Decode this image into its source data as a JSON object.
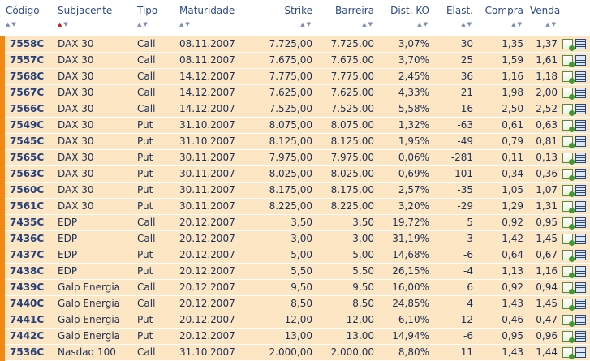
{
  "columns": [
    {
      "label": "Código",
      "sort": "both"
    },
    {
      "label": "Subjacente",
      "sort": "desc-active"
    },
    {
      "label": "Tipo",
      "sort": "both"
    },
    {
      "label": "Maturidade",
      "sort": "both"
    },
    {
      "label": "Strike",
      "sort": "both"
    },
    {
      "label": "Barreira",
      "sort": "both"
    },
    {
      "label": "Dist. KO",
      "sort": "both"
    },
    {
      "label": "Elast.",
      "sort": "both"
    },
    {
      "label": "Compra",
      "sort": "both"
    },
    {
      "label": "Venda",
      "sort": "both"
    }
  ],
  "icons": {
    "details": "document-plus-icon",
    "calculator": "calculator-icon"
  },
  "colors": {
    "row_bg": "#fde6c4",
    "row_marker": "#f08a14",
    "header_text": "#2d4a86"
  },
  "rows": [
    {
      "code": "7558C",
      "underlying": "DAX 30",
      "type": "Call",
      "maturity": "08.11.2007",
      "strike": "7.725,00",
      "barrier": "7.725,00",
      "dist_ko": "3,07%",
      "elast": "30",
      "buy": "1,35",
      "sell": "1,37"
    },
    {
      "code": "7557C",
      "underlying": "DAX 30",
      "type": "Call",
      "maturity": "08.11.2007",
      "strike": "7.675,00",
      "barrier": "7.675,00",
      "dist_ko": "3,70%",
      "elast": "25",
      "buy": "1,59",
      "sell": "1,61"
    },
    {
      "code": "7568C",
      "underlying": "DAX 30",
      "type": "Call",
      "maturity": "14.12.2007",
      "strike": "7.775,00",
      "barrier": "7.775,00",
      "dist_ko": "2,45%",
      "elast": "36",
      "buy": "1,16",
      "sell": "1,18"
    },
    {
      "code": "7567C",
      "underlying": "DAX 30",
      "type": "Call",
      "maturity": "14.12.2007",
      "strike": "7.625,00",
      "barrier": "7.625,00",
      "dist_ko": "4,33%",
      "elast": "21",
      "buy": "1,98",
      "sell": "2,00"
    },
    {
      "code": "7566C",
      "underlying": "DAX 30",
      "type": "Call",
      "maturity": "14.12.2007",
      "strike": "7.525,00",
      "barrier": "7.525,00",
      "dist_ko": "5,58%",
      "elast": "16",
      "buy": "2,50",
      "sell": "2,52"
    },
    {
      "code": "7549C",
      "underlying": "DAX 30",
      "type": "Put",
      "maturity": "31.10.2007",
      "strike": "8.075,00",
      "barrier": "8.075,00",
      "dist_ko": "1,32%",
      "elast": "-63",
      "buy": "0,61",
      "sell": "0,63"
    },
    {
      "code": "7545C",
      "underlying": "DAX 30",
      "type": "Put",
      "maturity": "31.10.2007",
      "strike": "8.125,00",
      "barrier": "8.125,00",
      "dist_ko": "1,95%",
      "elast": "-49",
      "buy": "0,79",
      "sell": "0,81"
    },
    {
      "code": "7565C",
      "underlying": "DAX 30",
      "type": "Put",
      "maturity": "30.11.2007",
      "strike": "7.975,00",
      "barrier": "7.975,00",
      "dist_ko": "0,06%",
      "elast": "-281",
      "buy": "0,11",
      "sell": "0,13"
    },
    {
      "code": "7563C",
      "underlying": "DAX 30",
      "type": "Put",
      "maturity": "30.11.2007",
      "strike": "8.025,00",
      "barrier": "8.025,00",
      "dist_ko": "0,69%",
      "elast": "-101",
      "buy": "0,34",
      "sell": "0,36"
    },
    {
      "code": "7560C",
      "underlying": "DAX 30",
      "type": "Put",
      "maturity": "30.11.2007",
      "strike": "8.175,00",
      "barrier": "8.175,00",
      "dist_ko": "2,57%",
      "elast": "-35",
      "buy": "1,05",
      "sell": "1,07"
    },
    {
      "code": "7561C",
      "underlying": "DAX 30",
      "type": "Put",
      "maturity": "30.11.2007",
      "strike": "8.225,00",
      "barrier": "8.225,00",
      "dist_ko": "3,20%",
      "elast": "-29",
      "buy": "1,29",
      "sell": "1,31"
    },
    {
      "code": "7435C",
      "underlying": "EDP",
      "type": "Call",
      "maturity": "20.12.2007",
      "strike": "3,50",
      "barrier": "3,50",
      "dist_ko": "19,72%",
      "elast": "5",
      "buy": "0,92",
      "sell": "0,95"
    },
    {
      "code": "7436C",
      "underlying": "EDP",
      "type": "Call",
      "maturity": "20.12.2007",
      "strike": "3,00",
      "barrier": "3,00",
      "dist_ko": "31,19%",
      "elast": "3",
      "buy": "1,42",
      "sell": "1,45"
    },
    {
      "code": "7437C",
      "underlying": "EDP",
      "type": "Put",
      "maturity": "20.12.2007",
      "strike": "5,00",
      "barrier": "5,00",
      "dist_ko": "14,68%",
      "elast": "-6",
      "buy": "0,64",
      "sell": "0,67"
    },
    {
      "code": "7438C",
      "underlying": "EDP",
      "type": "Put",
      "maturity": "20.12.2007",
      "strike": "5,50",
      "barrier": "5,50",
      "dist_ko": "26,15%",
      "elast": "-4",
      "buy": "1,13",
      "sell": "1,16"
    },
    {
      "code": "7439C",
      "underlying": "Galp Energia",
      "type": "Call",
      "maturity": "20.12.2007",
      "strike": "9,50",
      "barrier": "9,50",
      "dist_ko": "16,00%",
      "elast": "6",
      "buy": "0,92",
      "sell": "0,94"
    },
    {
      "code": "7440C",
      "underlying": "Galp Energia",
      "type": "Call",
      "maturity": "20.12.2007",
      "strike": "8,50",
      "barrier": "8,50",
      "dist_ko": "24,85%",
      "elast": "4",
      "buy": "1,43",
      "sell": "1,45"
    },
    {
      "code": "7441C",
      "underlying": "Galp Energia",
      "type": "Put",
      "maturity": "20.12.2007",
      "strike": "12,00",
      "barrier": "12,00",
      "dist_ko": "6,10%",
      "elast": "-12",
      "buy": "0,46",
      "sell": "0,47"
    },
    {
      "code": "7442C",
      "underlying": "Galp Energia",
      "type": "Put",
      "maturity": "20.12.2007",
      "strike": "13,00",
      "barrier": "13,00",
      "dist_ko": "14,94%",
      "elast": "-6",
      "buy": "0,95",
      "sell": "0,96"
    },
    {
      "code": "7536C",
      "underlying": "Nasdaq 100",
      "type": "Call",
      "maturity": "31.10.2007",
      "strike": "2.000,00",
      "barrier": "2.000,00",
      "dist_ko": "8,80%",
      "elast": "11",
      "buy": "1,43",
      "sell": "1,44"
    }
  ]
}
